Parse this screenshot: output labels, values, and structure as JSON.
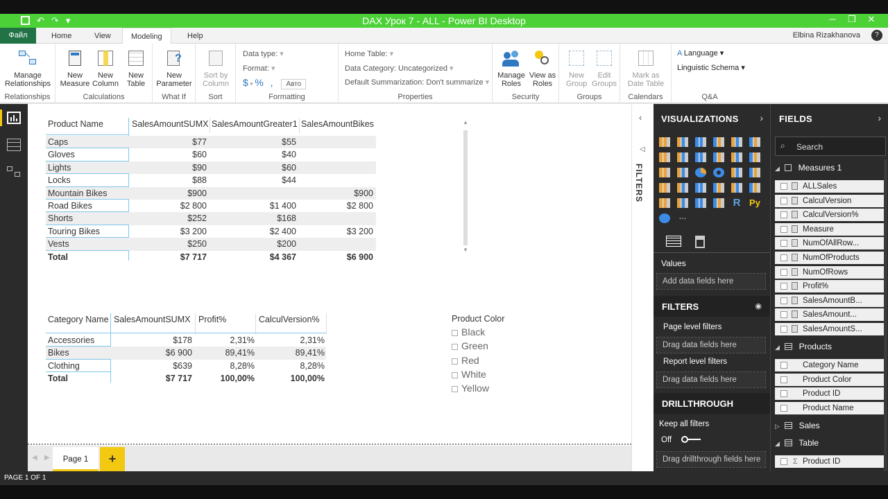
{
  "window": {
    "title": "DAX Урок 7 - ALL - Power BI Desktop",
    "minimize_icon": "minimize-icon",
    "maximize_icon": "restore-icon",
    "close_icon": "close-icon"
  },
  "tabs": {
    "file": "Файл",
    "items": [
      "Home",
      "View",
      "Modeling",
      "Help"
    ],
    "active": "Modeling",
    "user": "Elbina Rizakhanova",
    "help_glyph": "?"
  },
  "ribbon": {
    "groups": {
      "relationships": "Relationships",
      "calculations": "Calculations",
      "whatif": "What If",
      "sort": "Sort",
      "formatting": "Formatting",
      "properties": "Properties",
      "security": "Security",
      "groups": "Groups",
      "calendars": "Calendars",
      "qa": "Q&A"
    },
    "buttons": {
      "manage_relationships": [
        "Manage",
        "Relationships"
      ],
      "new_measure": [
        "New",
        "Measure"
      ],
      "new_column": [
        "New",
        "Column"
      ],
      "new_table": [
        "New",
        "Table"
      ],
      "new_parameter": [
        "New",
        "Parameter"
      ],
      "sort_by_column": [
        "Sort by",
        "Column"
      ],
      "manage_roles": [
        "Manage",
        "Roles"
      ],
      "view_as_roles": [
        "View as",
        "Roles"
      ],
      "new_group": [
        "New",
        "Group"
      ],
      "edit_groups": [
        "Edit",
        "Groups"
      ],
      "mark_as_date_table": [
        "Mark as",
        "Date Table"
      ]
    },
    "formatting": {
      "data_type": "Data type:",
      "format": "Format:",
      "currency": "$",
      "percent": "%",
      "comma": ",",
      "decimals": "Авто"
    },
    "properties": {
      "home_table": "Home Table:",
      "data_category": "Data Category: Uncategorized",
      "default_summarization": "Default Summarization: Don't summarize"
    },
    "qa": {
      "language": "Language",
      "linguistic_schema": "Linguistic Schema"
    }
  },
  "table1": {
    "headers": [
      "Product Name",
      "SalesAmountSUMX",
      "SalesAmountGreater1",
      "SalesAmountBikes"
    ],
    "rows": [
      [
        "Caps",
        "$77",
        "$55",
        ""
      ],
      [
        "Gloves",
        "$60",
        "$40",
        ""
      ],
      [
        "Lights",
        "$90",
        "$60",
        ""
      ],
      [
        "Locks",
        "$88",
        "$44",
        ""
      ],
      [
        "Mountain Bikes",
        "$900",
        "",
        "$900"
      ],
      [
        "Road Bikes",
        "$2 800",
        "$1 400",
        "$2 800"
      ],
      [
        "Shorts",
        "$252",
        "$168",
        ""
      ],
      [
        "Touring Bikes",
        "$3 200",
        "$2 400",
        "$3 200"
      ],
      [
        "Vests",
        "$250",
        "$200",
        ""
      ]
    ],
    "total": [
      "Total",
      "$7 717",
      "$4 367",
      "$6 900"
    ]
  },
  "table2": {
    "headers": [
      "Category Name",
      "SalesAmountSUMX",
      "Profit%",
      "CalculVersion%"
    ],
    "rows": [
      [
        "Accessories",
        "$178",
        "2,31%",
        "2,31%"
      ],
      [
        "Bikes",
        "$6 900",
        "89,41%",
        "89,41%"
      ],
      [
        "Clothing",
        "$639",
        "8,28%",
        "8,28%"
      ]
    ],
    "total": [
      "Total",
      "$7 717",
      "100,00%",
      "100,00%"
    ]
  },
  "slicer": {
    "title": "Product Color",
    "options": [
      "Black",
      "Green",
      "Red",
      "White",
      "Yellow"
    ]
  },
  "pages": {
    "current": "Page 1",
    "add": "+"
  },
  "status": "PAGE 1 OF 1",
  "filters_strip": "FILTERS",
  "visualizations": {
    "title": "VISUALIZATIONS",
    "more": "...",
    "py": "Py",
    "r": "R",
    "values_label": "Values",
    "values_well": "Add data fields here",
    "filters_title": "FILTERS",
    "page_level": "Page level filters",
    "page_well": "Drag data fields here",
    "report_level": "Report level filters",
    "report_well": "Drag data fields here",
    "drillthrough_title": "DRILLTHROUGH",
    "keep_all_filters": "Keep all filters",
    "toggle_state": "Off",
    "drill_well": "Drag drillthrough fields here"
  },
  "fields": {
    "title": "FIELDS",
    "search_placeholder": "Search",
    "measures_group": "Measures 1",
    "measures": [
      "ALLSales",
      "CalculVersion",
      "CalculVersion%",
      "Measure",
      "NumOfAllRow...",
      "NumOfProducts",
      "NumOfRows",
      "Profit%",
      "SalesAmountB...",
      "SalesAmount...",
      "SalesAmountS..."
    ],
    "products_group": "Products",
    "products": [
      "Category Name",
      "Product Color",
      "Product ID",
      "Product Name"
    ],
    "sales_group": "Sales",
    "table_group": "Table",
    "table_fields": [
      "Product ID"
    ]
  },
  "colors": {
    "title_green": "#4cd137",
    "accent_yellow": "#f2c811",
    "pane_dark": "#2b2b2b",
    "table_line": "#7fc6e8"
  }
}
